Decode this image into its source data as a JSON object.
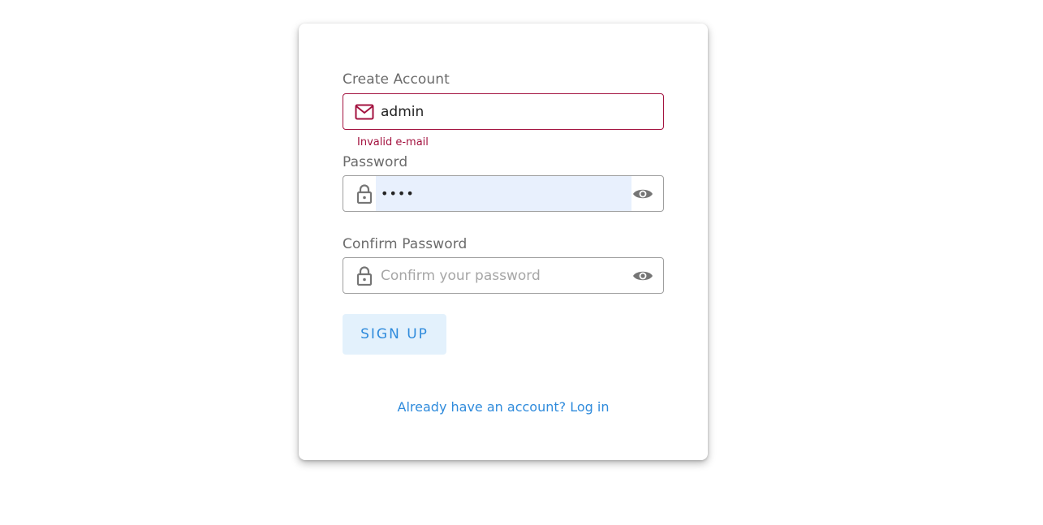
{
  "form": {
    "email": {
      "label": "Create Account",
      "value": "admin",
      "error": "Invalid e-mail",
      "icon": "mail-icon"
    },
    "password": {
      "label": "Password",
      "value": "••••",
      "icon": "lock-icon",
      "toggle_icon": "eye-icon"
    },
    "confirm_password": {
      "label": "Confirm Password",
      "placeholder": "Confirm your password",
      "icon": "lock-icon",
      "toggle_icon": "eye-icon"
    },
    "signup_label": "SIGN UP",
    "login_link": "Already have an account? Log in"
  },
  "colors": {
    "error": "#a3123f",
    "accent": "#2f8bdc",
    "button_bg": "#e3f1fc",
    "autofill_bg": "#e8f0fd",
    "icon_gray": "#757575"
  }
}
